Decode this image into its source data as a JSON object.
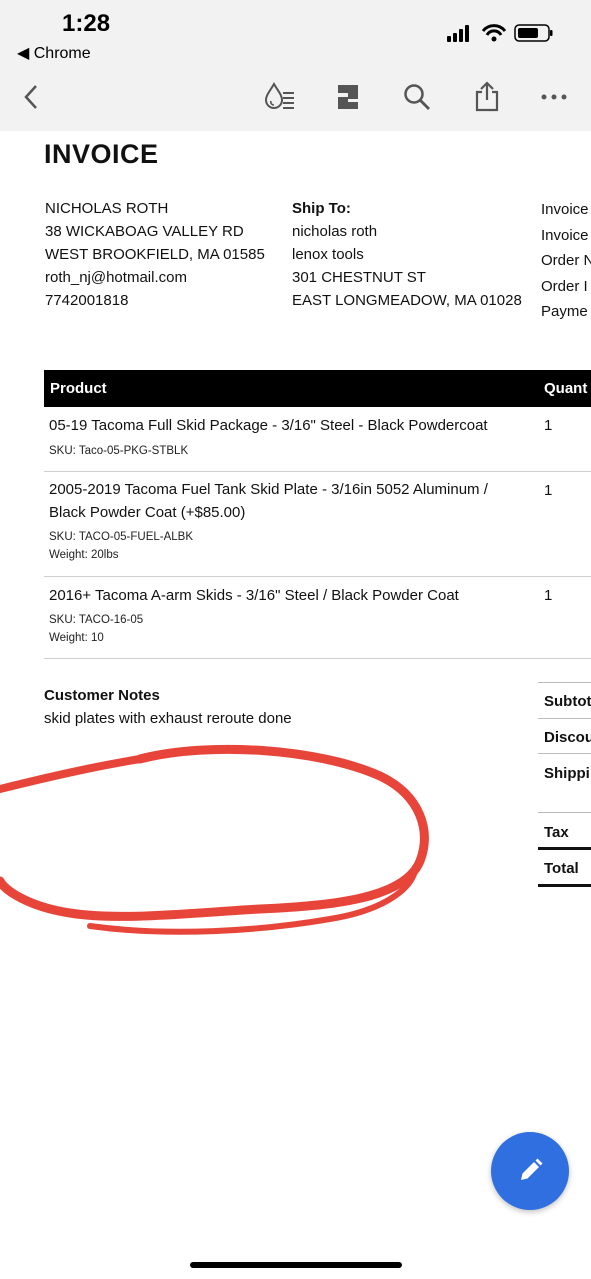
{
  "status_bar": {
    "time": "1:28",
    "back_app": "◀ Chrome"
  },
  "toolbar": {
    "icons": [
      "back-icon",
      "water-drop-list-icon",
      "document-layout-icon",
      "search-icon",
      "share-icon",
      "more-icon"
    ]
  },
  "invoice": {
    "title": "INVOICE",
    "bill_from": {
      "name": "NICHOLAS ROTH",
      "street": "38 WICKABOAG VALLEY RD",
      "city": "WEST BROOKFIELD, MA 01585",
      "email": "roth_nj@hotmail.com",
      "phone": "7742001818"
    },
    "ship_to": {
      "heading": "Ship To:",
      "name": "nicholas roth",
      "company": "lenox tools",
      "street": "301 CHESTNUT ST",
      "city": "EAST LONGMEADOW, MA 01028"
    },
    "meta_labels": [
      "Invoice",
      "Invoice",
      "Order N",
      "Order I",
      "Payme"
    ],
    "table": {
      "headers": {
        "product": "Product",
        "quantity": "Quant"
      },
      "rows": [
        {
          "name_line1": "05-19 Tacoma Full Skid Package - 3/16\" Steel - Black Powdercoat",
          "name_line2": "",
          "sku": "SKU:  Taco-05-PKG-STBLK",
          "weight": "",
          "qty": "1"
        },
        {
          "name_line1": "2005-2019 Tacoma Fuel Tank Skid Plate - 3/16in 5052 Aluminum /",
          "name_line2": "Black Powder Coat (+$85.00)",
          "sku": "SKU:  TACO-05-FUEL-ALBK",
          "weight": "Weight:  20lbs",
          "qty": "1"
        },
        {
          "name_line1": "2016+ Tacoma A-arm Skids - 3/16\" Steel / Black Powder Coat",
          "name_line2": "",
          "sku": "SKU:  TACO-16-05",
          "weight": "Weight:  10",
          "qty": "1"
        }
      ]
    },
    "customer_notes": {
      "heading": "Customer Notes",
      "text": "skid plates with exhaust reroute done"
    },
    "totals": [
      "Subtot",
      "Discou",
      "Shippi",
      "Tax",
      "Total"
    ]
  },
  "colors": {
    "accent_fab": "#2f6fe0",
    "annotation_red": "#e8453a",
    "header_bg": "#000000"
  },
  "fab": {
    "icon": "pencil-icon"
  }
}
